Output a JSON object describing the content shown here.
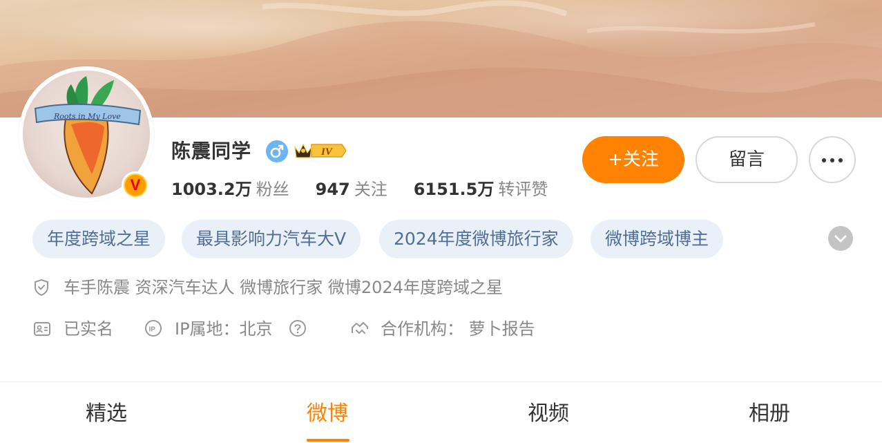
{
  "profile": {
    "name": "陈震同学",
    "level_badge": "IV",
    "verified_badge": "V",
    "stats": [
      {
        "value": "1003.2万",
        "label": "粉丝"
      },
      {
        "value": "947",
        "label": "关注"
      },
      {
        "value": "6151.5万",
        "label": "转评赞"
      }
    ]
  },
  "actions": {
    "follow_label": "+关注",
    "message_label": "留言",
    "more_icon": "more-dots-icon"
  },
  "tags": [
    "年度跨域之星",
    "最具影响力汽车大V",
    "2024年度微博旅行家",
    "微博跨域博主"
  ],
  "info": {
    "verification": "车手陈震 资深汽车达人 微博旅行家 微博2024年度跨域之星",
    "real_name": "已实名",
    "ip_location": "IP属地：北京",
    "agency": "合作机构：  萝卜报告"
  },
  "tabs": [
    {
      "label": "精选",
      "active": false
    },
    {
      "label": "微博",
      "active": true
    },
    {
      "label": "视频",
      "active": false
    },
    {
      "label": "相册",
      "active": false
    }
  ],
  "colors": {
    "accent": "#ff8200",
    "tag_bg": "#eaf0f7",
    "tag_text": "#4f6e96",
    "muted_text": "#888888",
    "gender_male": "#6db4f5"
  }
}
